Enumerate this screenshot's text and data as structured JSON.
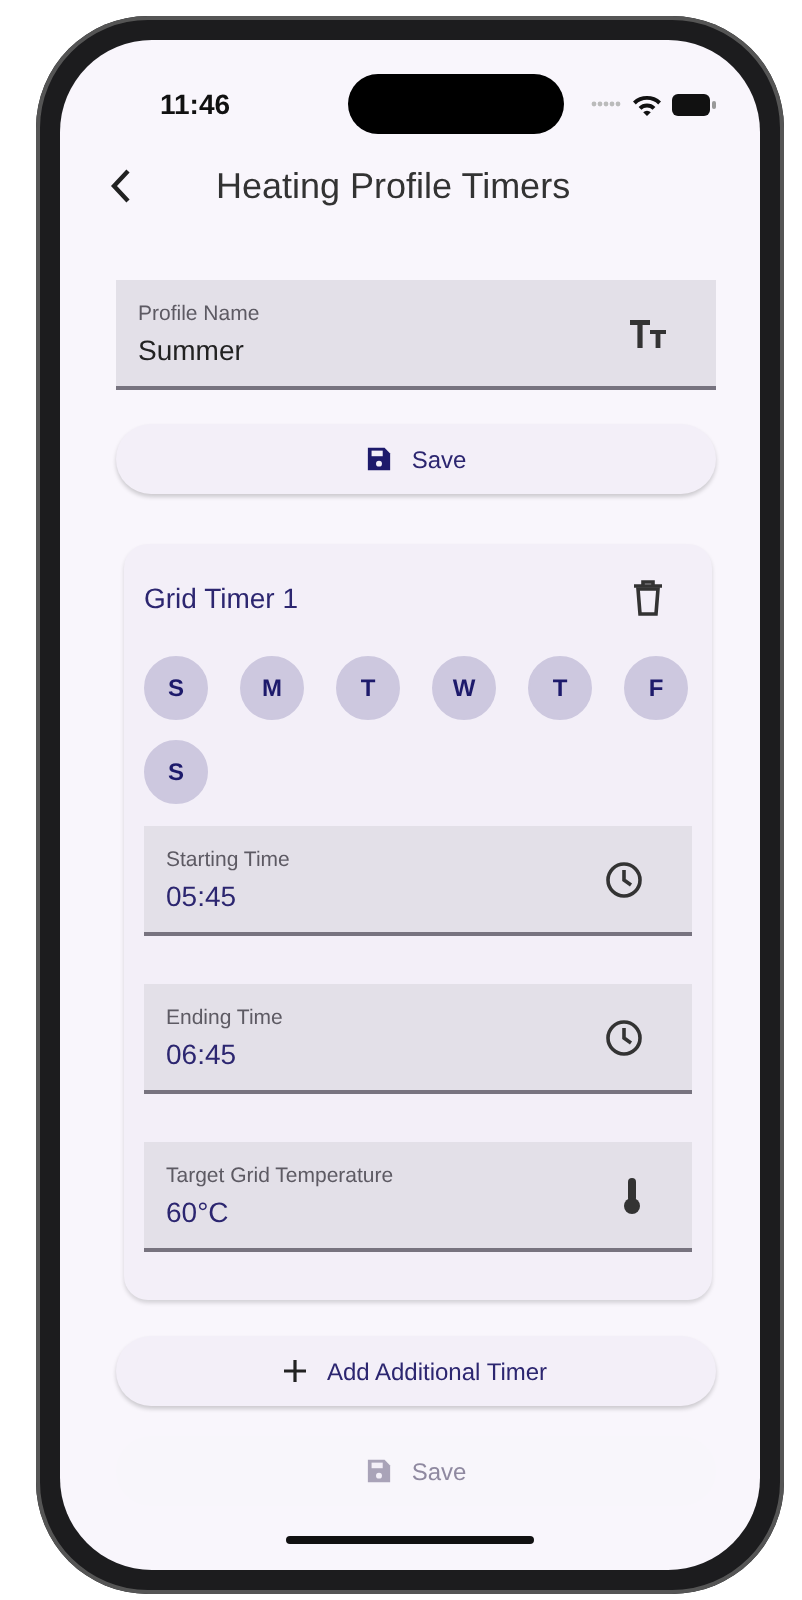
{
  "status_bar": {
    "time": "11:46"
  },
  "header": {
    "title": "Heating Profile Timers"
  },
  "profile_name": {
    "label": "Profile Name",
    "value": "Summer"
  },
  "save_button": {
    "label": "Save"
  },
  "timer": {
    "title": "Grid Timer 1",
    "days": [
      {
        "label": "S",
        "selected": true
      },
      {
        "label": "M",
        "selected": true
      },
      {
        "label": "T",
        "selected": true
      },
      {
        "label": "W",
        "selected": true
      },
      {
        "label": "T",
        "selected": true
      },
      {
        "label": "F",
        "selected": true
      },
      {
        "label": "S",
        "selected": true
      }
    ],
    "fields": [
      {
        "kind": "time",
        "label": "Starting Time",
        "value": "05:45"
      },
      {
        "kind": "time",
        "label": "Ending Time",
        "value": "06:45"
      },
      {
        "kind": "temperature",
        "label": "Target Grid Temperature",
        "value": "60°C"
      }
    ]
  },
  "add_timer_button": {
    "label": "Add Additional Timer"
  },
  "bottom_save_button": {
    "label": "Save"
  }
}
